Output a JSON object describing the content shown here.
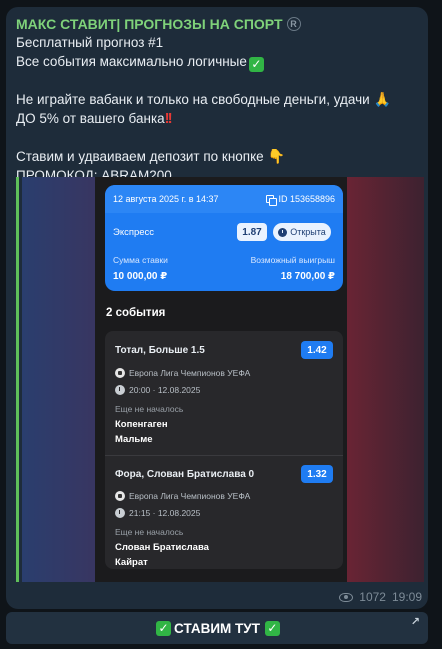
{
  "channel": {
    "name": "МАКС СТАВИТ| ПРОГНОЗЫ НА СПОРТ",
    "mark_icon": "registered-icon"
  },
  "message": {
    "line1": "Бесплатный прогноз #1",
    "line2": "Все события максимально логичные",
    "line3": "Не играйте вабанк и только на свободные деньги, удачи",
    "line4": "ДО 5% от вашего банка",
    "line5": "Ставим и удваиваем депозит по кнопке",
    "line6": "ПРОМОКОД: ABRAM200",
    "emoji": {
      "check": "✓",
      "bang": "!!",
      "pray": "🙏",
      "point": "👇"
    }
  },
  "ticket": {
    "date": "12 августа 2025 г. в 14:37",
    "id": "ID 153658896",
    "type": "Экспресс",
    "odds": "1.87",
    "status": "Открыта",
    "stake_label": "Сумма ставки",
    "stake_value": "10 000,00 ₽",
    "win_label": "Возможный выигрыш",
    "win_value": "18 700,00 ₽"
  },
  "events_title": "2 события",
  "events": [
    {
      "title": "Тотал, Больше 1.5",
      "odds": "1.42",
      "league": "Европа Лига Чемпионов УЕФА",
      "datetime": "20:00 · 12.08.2025",
      "status": "Еще не началось",
      "team1": "Копенгаген",
      "team2": "Мальме"
    },
    {
      "title": "Фора, Слован Братислава 0",
      "odds": "1.32",
      "league": "Европа Лига Чемпионов УЕФА",
      "datetime": "21:15 · 12.08.2025",
      "status": "Еще не началось",
      "team1": "Слован Братислава",
      "team2": "Кайрат"
    }
  ],
  "meta": {
    "views": "1072",
    "time": "19:09"
  },
  "cta": {
    "label": "СТАВИМ ТУТ",
    "check": "✓",
    "arrow": "↗"
  }
}
